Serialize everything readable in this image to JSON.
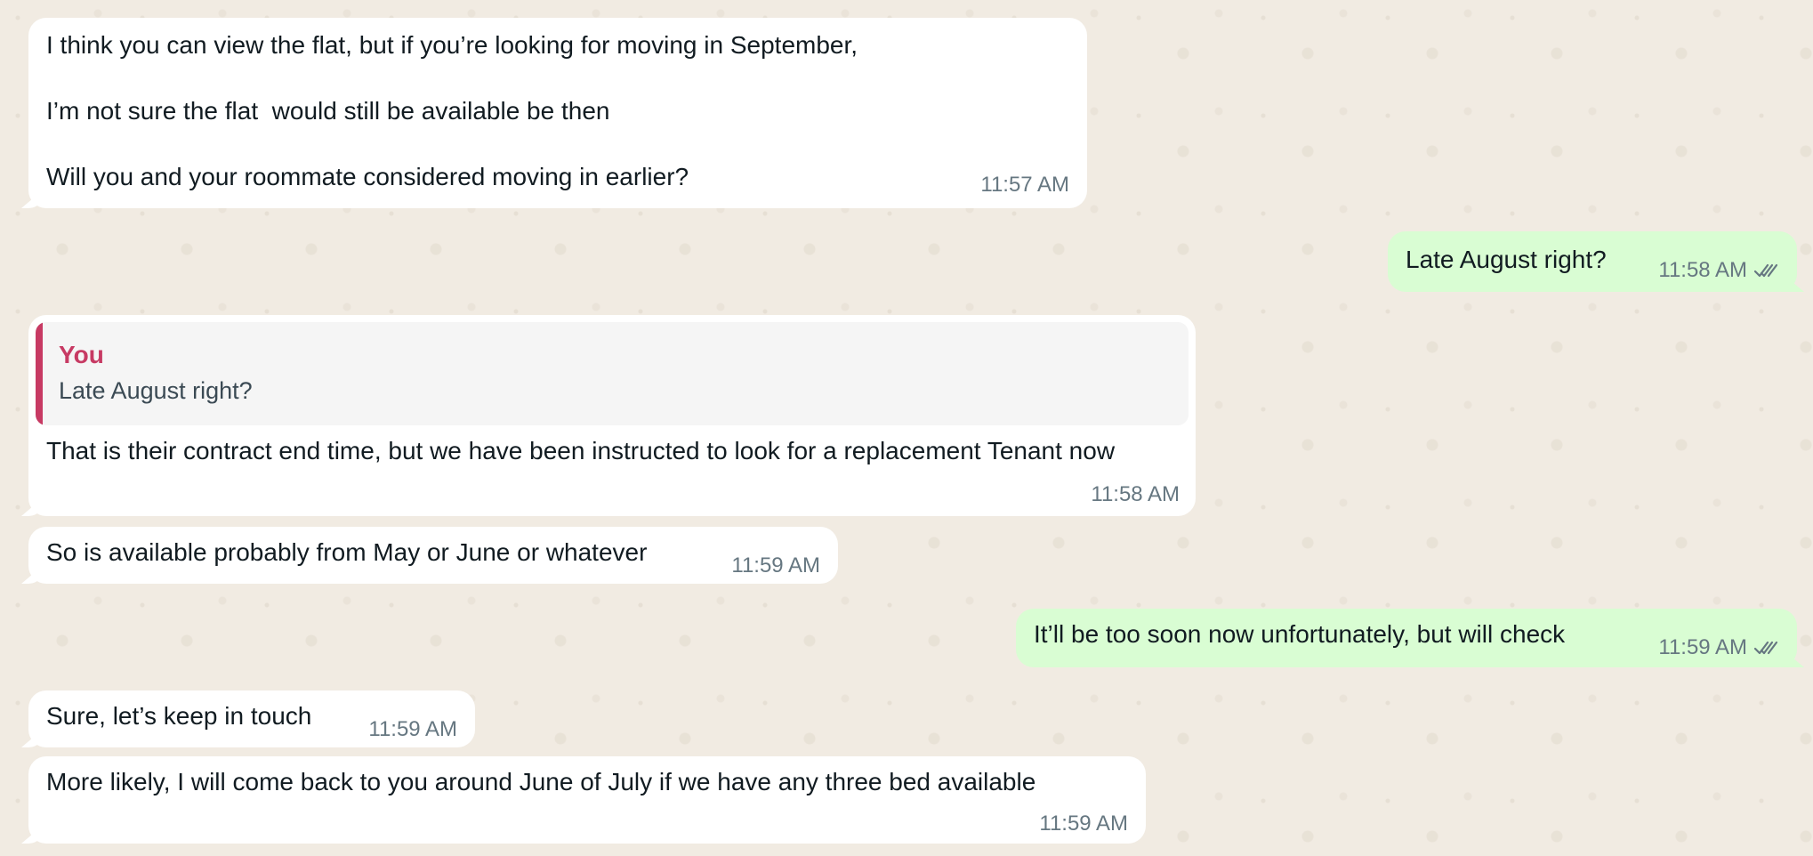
{
  "messages": [
    {
      "direction": "incoming",
      "text": "I think you can view the flat, but if you’re looking for moving in September,\n\nI’m not sure the flat  would still be available be then\n\nWill you and your roommate considered moving in earlier?",
      "time": "11:57 AM"
    },
    {
      "direction": "outgoing",
      "text": "Late August right?",
      "time": "11:58 AM",
      "status": "read"
    },
    {
      "direction": "incoming",
      "quote": {
        "author": "You",
        "text": "Late August right?"
      },
      "text": "That is their contract end time, but we have been instructed to look for a replacement Tenant now",
      "time": "11:58 AM"
    },
    {
      "direction": "incoming",
      "text": "So is available probably from May or June or whatever",
      "time": "11:59 AM"
    },
    {
      "direction": "outgoing",
      "text": "It’ll be too soon now unfortunately, but will check",
      "time": "11:59 AM",
      "status": "read"
    },
    {
      "direction": "incoming",
      "text": "Sure, let’s keep in touch",
      "time": "11:59 AM"
    },
    {
      "direction": "incoming",
      "text": "More likely, I will come back to you around June of July if we have any three bed available",
      "time": "11:59 AM"
    }
  ],
  "colors": {
    "background": "#f1ebe2",
    "incoming_bubble": "#ffffff",
    "outgoing_bubble": "#d9fdd3",
    "quote_accent": "#c73a63",
    "timestamp": "#667781",
    "read_ticks": "#667781"
  },
  "icons": {
    "read_status": "double-check-icon"
  }
}
